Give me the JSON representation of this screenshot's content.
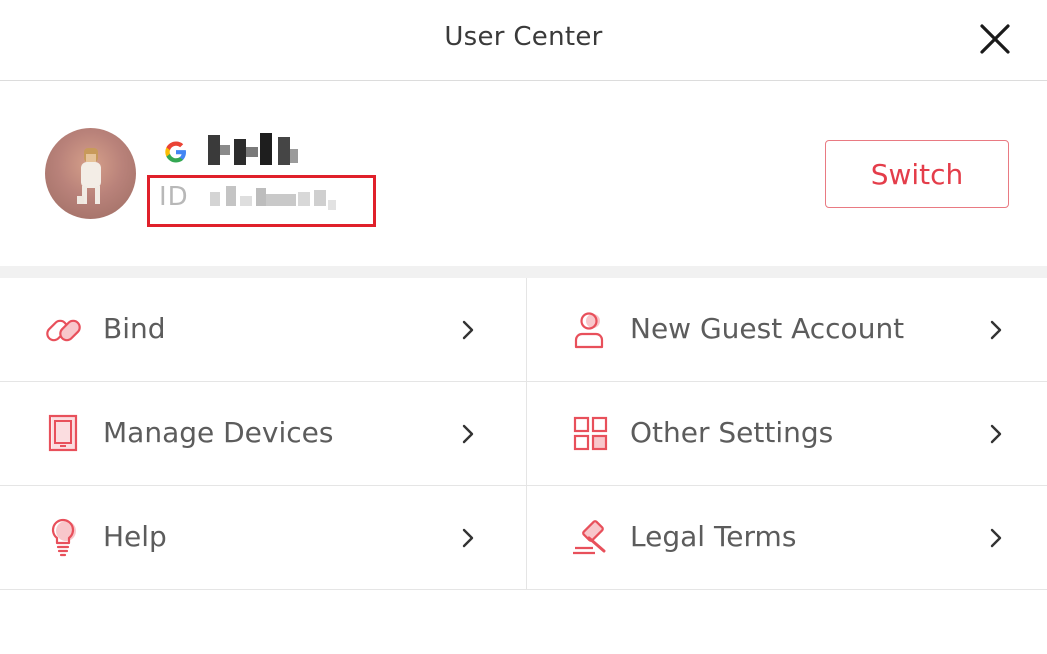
{
  "header": {
    "title": "User Center"
  },
  "profile": {
    "account_provider_icon": "google-icon",
    "id_label": "ID",
    "switch_label": "Switch"
  },
  "menu": {
    "items": [
      {
        "label": "Bind",
        "icon": "link-icon"
      },
      {
        "label": "New Guest Account",
        "icon": "guest-user-icon"
      },
      {
        "label": "Manage Devices",
        "icon": "device-icon"
      },
      {
        "label": "Other Settings",
        "icon": "grid-settings-icon"
      },
      {
        "label": "Help",
        "icon": "lightbulb-icon"
      },
      {
        "label": "Legal Terms",
        "icon": "gavel-icon"
      }
    ]
  },
  "colors": {
    "accent": "#e43d4a",
    "highlight_box": "#e0202a",
    "text": "#5c5c5c",
    "divider": "#e5e5e5"
  }
}
